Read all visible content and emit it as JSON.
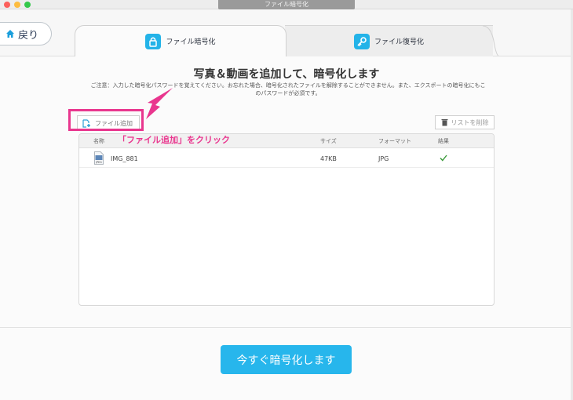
{
  "window": {
    "title": "ファイル暗号化"
  },
  "nav": {
    "back_label": "戻り"
  },
  "tabs": [
    {
      "label": "ファイル暗号化",
      "icon": "lock-icon",
      "active": true
    },
    {
      "label": "ファイル復号化",
      "icon": "key-icon",
      "active": false
    }
  ],
  "main": {
    "headline": "写真＆動画を追加して、暗号化します",
    "notice": "ご注意：入力した暗号化パスワードを覚えてください。お忘れた場合、暗号化されたファイルを解除することができません。また、エクスポートの暗号化にもこのパスワードが必須です。"
  },
  "toolbar": {
    "add_file_label": "ファイル追加",
    "clear_list_label": "リストを削除"
  },
  "annotation": {
    "callout_text": "「ファイル追加」をクリック",
    "color": "#e9368e"
  },
  "table": {
    "columns": [
      "名称",
      "サイズ",
      "フォーマット",
      "結果"
    ],
    "rows": [
      {
        "name": "IMG_881",
        "size": "47KB",
        "format": "JPG",
        "result_icon": "checkmark-icon",
        "file_icon_label": "JPEG"
      }
    ]
  },
  "footer": {
    "encrypt_label": "今すぐ暗号化します"
  },
  "colors": {
    "accent": "#27b6ec",
    "success": "#3a9a3a"
  }
}
